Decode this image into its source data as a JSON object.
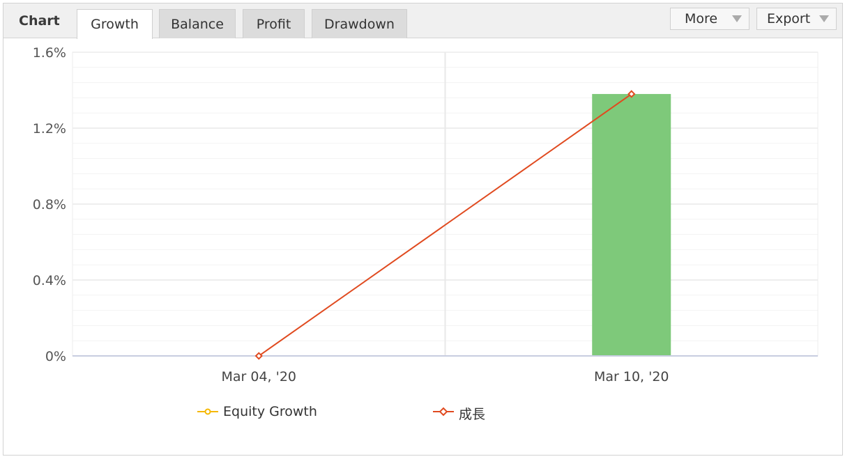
{
  "header": {
    "title": "Chart",
    "tabs": [
      {
        "label": "Growth",
        "active": true
      },
      {
        "label": "Balance",
        "active": false
      },
      {
        "label": "Profit",
        "active": false
      },
      {
        "label": "Drawdown",
        "active": false
      }
    ],
    "more_label": "More",
    "export_label": "Export"
  },
  "legend": [
    {
      "name": "Equity Growth",
      "color": "#f5b800"
    },
    {
      "name": "成長",
      "color": "#e04a1f"
    }
  ],
  "colors": {
    "bar": "#7ec97a",
    "line": "#e04a1f",
    "grid": "#e8e8e8",
    "axis": "#c8cde0"
  },
  "chart_data": {
    "type": "bar",
    "categories": [
      "Mar 04, '20",
      "Mar 10, '20"
    ],
    "series": [
      {
        "name": "Equity Growth",
        "type": "bar",
        "values": [
          0,
          1.38
        ]
      },
      {
        "name": "成長",
        "type": "line",
        "values": [
          0,
          1.38
        ]
      }
    ],
    "ylim": [
      0,
      1.6
    ],
    "yticks": [
      0,
      0.4,
      0.8,
      1.2,
      1.6
    ],
    "ytick_labels": [
      "0%",
      "0.4%",
      "0.8%",
      "1.2%",
      "1.6%"
    ],
    "grid": true,
    "legend_position": "bottom"
  }
}
